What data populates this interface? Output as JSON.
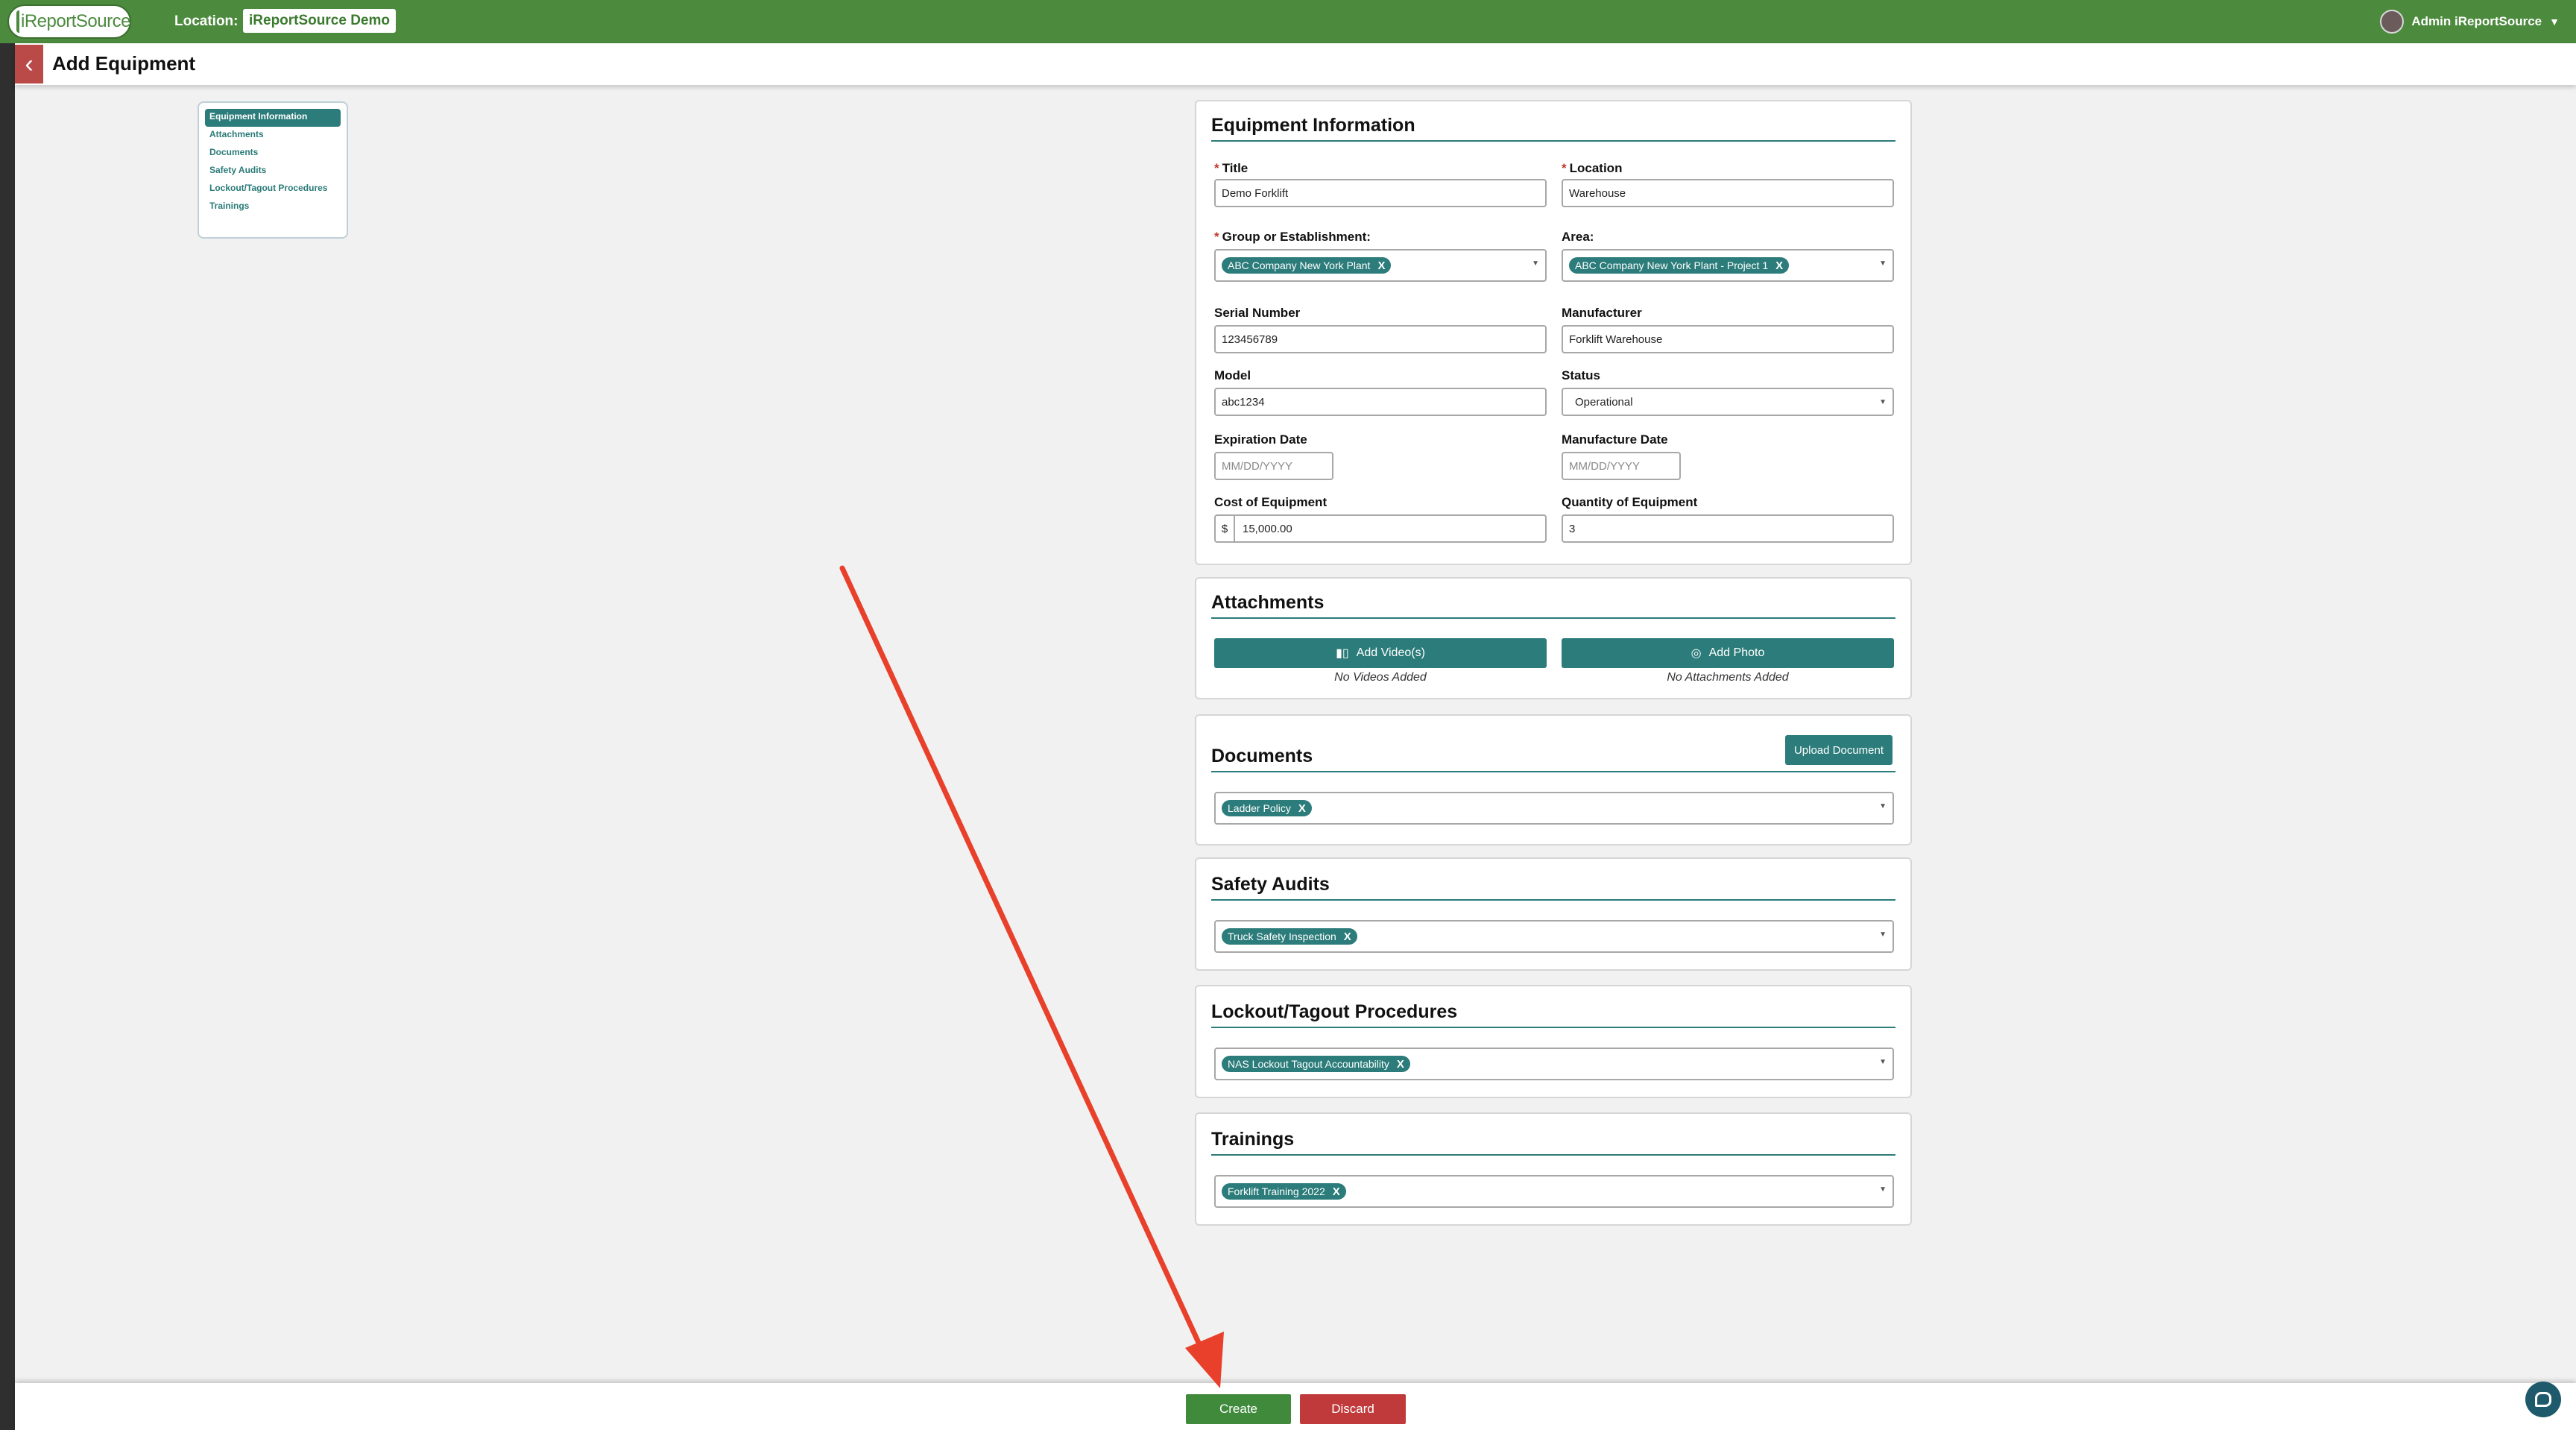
{
  "app": {
    "logo_text": "iReportSource",
    "location_label": "Location:",
    "location_value": "iReportSource Demo"
  },
  "user": {
    "name": "Admin iReportSource"
  },
  "page": {
    "title": "Add Equipment"
  },
  "nav": {
    "items": [
      {
        "label": "Equipment Information"
      },
      {
        "label": "Attachments"
      },
      {
        "label": "Documents"
      },
      {
        "label": "Safety Audits"
      },
      {
        "label": "Lockout/Tagout Procedures"
      },
      {
        "label": "Trainings"
      }
    ]
  },
  "equipment": {
    "heading": "Equipment Information",
    "title_label": "Title",
    "title_value": "Demo Forklift",
    "location_label": "Location",
    "location_value": "Warehouse",
    "group_label": "Group or Establishment:",
    "group_value": "ABC Company New York Plant",
    "area_label": "Area:",
    "area_value": "ABC Company New York Plant - Project 1",
    "serial_label": "Serial Number",
    "serial_value": "123456789",
    "manufacturer_label": "Manufacturer",
    "manufacturer_value": "Forklift Warehouse",
    "model_label": "Model",
    "model_value": "abc1234",
    "status_label": "Status",
    "status_value": "Operational",
    "expiration_label": "Expiration Date",
    "expiration_placeholder": "MM/DD/YYYY",
    "manufacture_date_label": "Manufacture Date",
    "manufacture_date_placeholder": "MM/DD/YYYY",
    "cost_label": "Cost of Equipment",
    "cost_prefix": "$",
    "cost_value": "15,000.00",
    "quantity_label": "Quantity of Equipment",
    "quantity_value": "3"
  },
  "attachments": {
    "heading": "Attachments",
    "add_video_label": "Add Video(s)",
    "videos_empty": "No Videos Added",
    "add_photo_label": "Add Photo",
    "attachments_empty": "No Attachments Added"
  },
  "documents": {
    "heading": "Documents",
    "upload_label": "Upload Document",
    "selected": "Ladder Policy"
  },
  "safety_audits": {
    "heading": "Safety Audits",
    "selected": "Truck Safety Inspection"
  },
  "lockout": {
    "heading": "Lockout/Tagout Procedures",
    "selected": "NAS Lockout Tagout Accountability"
  },
  "trainings": {
    "heading": "Trainings",
    "selected": "Forklift Training 2022"
  },
  "chip_remove": "X",
  "footer": {
    "create_label": "Create",
    "discard_label": "Discard"
  },
  "colors": {
    "brand_green": "#4c8a3e",
    "teal": "#2b7c7a",
    "discard_red": "#c0393b",
    "annotation_arrow": "#e8402a"
  }
}
